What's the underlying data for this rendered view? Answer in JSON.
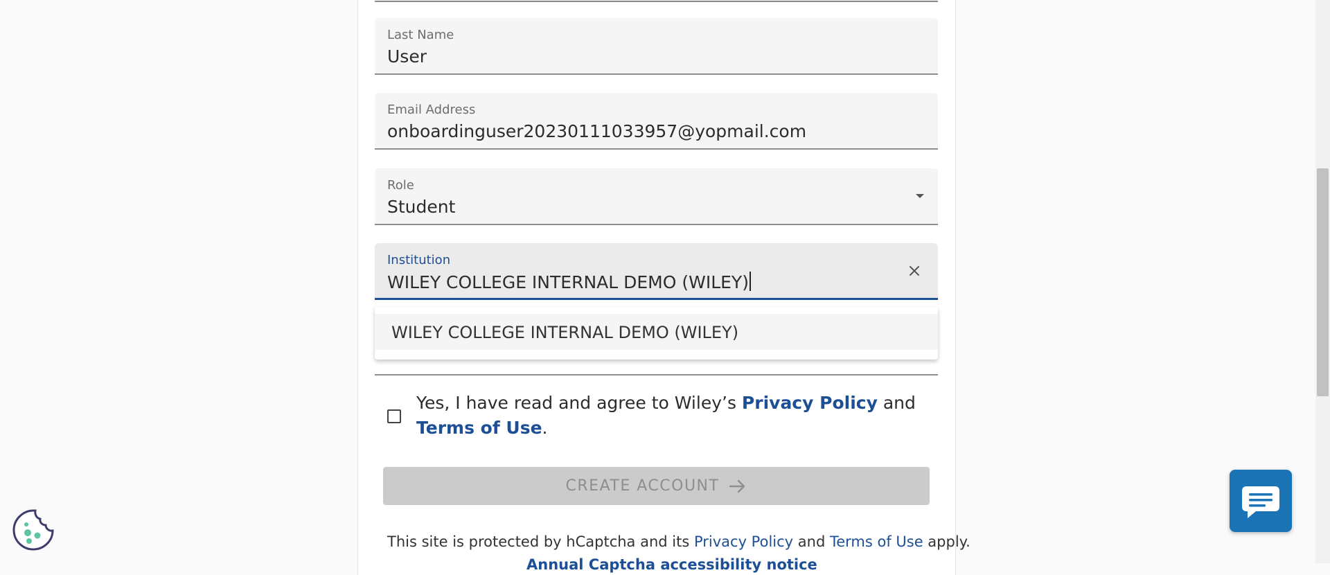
{
  "form": {
    "last_name": {
      "label": "Last Name",
      "value": "User"
    },
    "email": {
      "label": "Email Address",
      "value": "onboardinguser20230111033957@yopmail.com"
    },
    "role": {
      "label": "Role",
      "value": "Student"
    },
    "institution": {
      "label": "Institution",
      "value": "WILEY COLLEGE INTERNAL DEMO (WILEY)",
      "clear_icon": "close-icon"
    },
    "institution_options": [
      "WILEY COLLEGE INTERNAL DEMO (WILEY)"
    ],
    "consent": {
      "text_before": "Yes, I have read and agree to Wiley’s ",
      "privacy_link": "Privacy Policy",
      "and": " and ",
      "terms_link": "Terms of Use",
      "period": "."
    },
    "create_button": "CREATE ACCOUNT",
    "captcha": {
      "prefix": "This site is protected by hCaptcha and its ",
      "privacy_link": "Privacy Policy",
      "and": " and ",
      "terms_link": "Terms of Use",
      "suffix": " apply."
    },
    "cutoff_link": "Annual Captcha accessibility notice"
  },
  "colors": {
    "link": "#1c4f96",
    "focus": "#1c4f96",
    "chat": "#1a73b5",
    "disabled_button": "#cbcbcb"
  },
  "icons": {
    "chat": "chat-icon",
    "cookie": "cookie-icon",
    "arrow": "arrow-right-icon",
    "dropdown": "chevron-down-icon"
  }
}
